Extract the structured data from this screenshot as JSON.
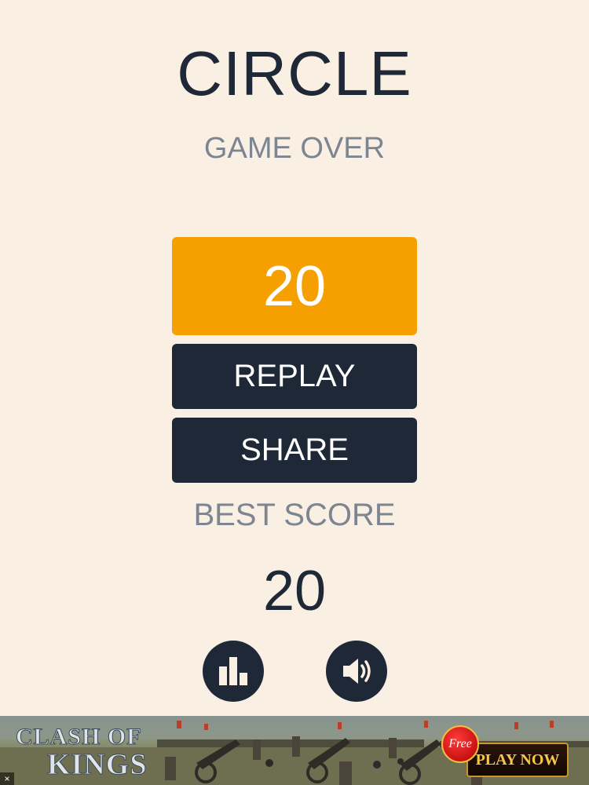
{
  "game": {
    "title": "CIRCLE",
    "status": "GAME OVER",
    "score": "20",
    "best_score_label": "BEST SCORE",
    "best_score": "20"
  },
  "buttons": {
    "replay": "REPLAY",
    "share": "SHARE"
  },
  "icons": {
    "leaderboard": "leaderboard-icon",
    "sound": "speaker-icon"
  },
  "ad": {
    "logo_line1": "CLASH OF",
    "logo_line2": "KINGS",
    "free_label": "Free",
    "cta": "PLAY NOW",
    "close": "×"
  },
  "colors": {
    "background": "#f9efe2",
    "dark": "#1e2837",
    "accent": "#f59f00",
    "muted": "#7d8592"
  }
}
